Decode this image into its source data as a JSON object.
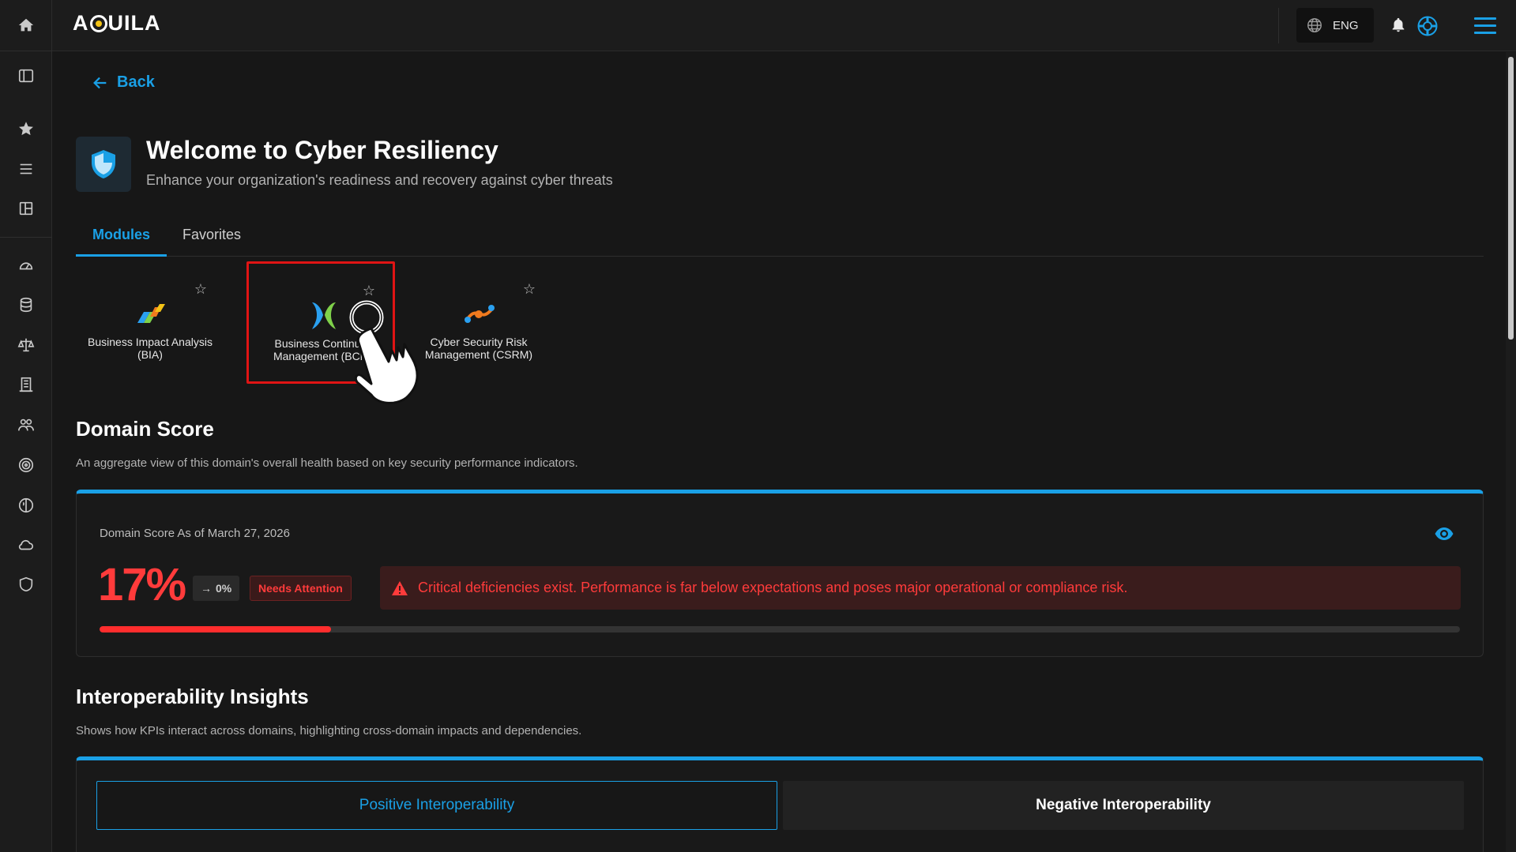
{
  "app": {
    "logo_text": "AQUILA",
    "logo_left": "A",
    "logo_right": "UILA"
  },
  "topbar": {
    "language": "ENG"
  },
  "nav": {
    "back_label": "Back"
  },
  "hero": {
    "title": "Welcome to Cyber Resiliency",
    "subtitle": "Enhance your organization's readiness and recovery against cyber threats"
  },
  "tabs": [
    {
      "label": "Modules",
      "active": true
    },
    {
      "label": "Favorites",
      "active": false
    }
  ],
  "modules": [
    {
      "label": "Business Impact Analysis (BIA)",
      "starred": false,
      "selected": false
    },
    {
      "label": "Business Continuity Management (BCM)",
      "starred": false,
      "selected": true
    },
    {
      "label": "Cyber Security Risk Management (CSRM)",
      "starred": false,
      "selected": false
    }
  ],
  "domain_score": {
    "title": "Domain Score",
    "description": "An aggregate view of this domain's overall health based on key security performance indicators.",
    "as_of": "Domain Score As of March 27, 2026",
    "percent_label": "17%",
    "percent_value": 17,
    "trend": "0%",
    "status": "Needs Attention",
    "alert": "Critical deficiencies exist. Performance is far below expectations and poses major operational or compliance risk."
  },
  "interoperability": {
    "title": "Interoperability Insights",
    "description": "Shows how KPIs interact across domains, highlighting cross-domain impacts and dependencies.",
    "positive_label": "Positive Interoperability",
    "negative_label": "Negative Interoperability"
  },
  "colors": {
    "accent": "#1aa0e6",
    "danger": "#ff3b3b",
    "background": "#171717",
    "surface": "#1c1c1c"
  }
}
